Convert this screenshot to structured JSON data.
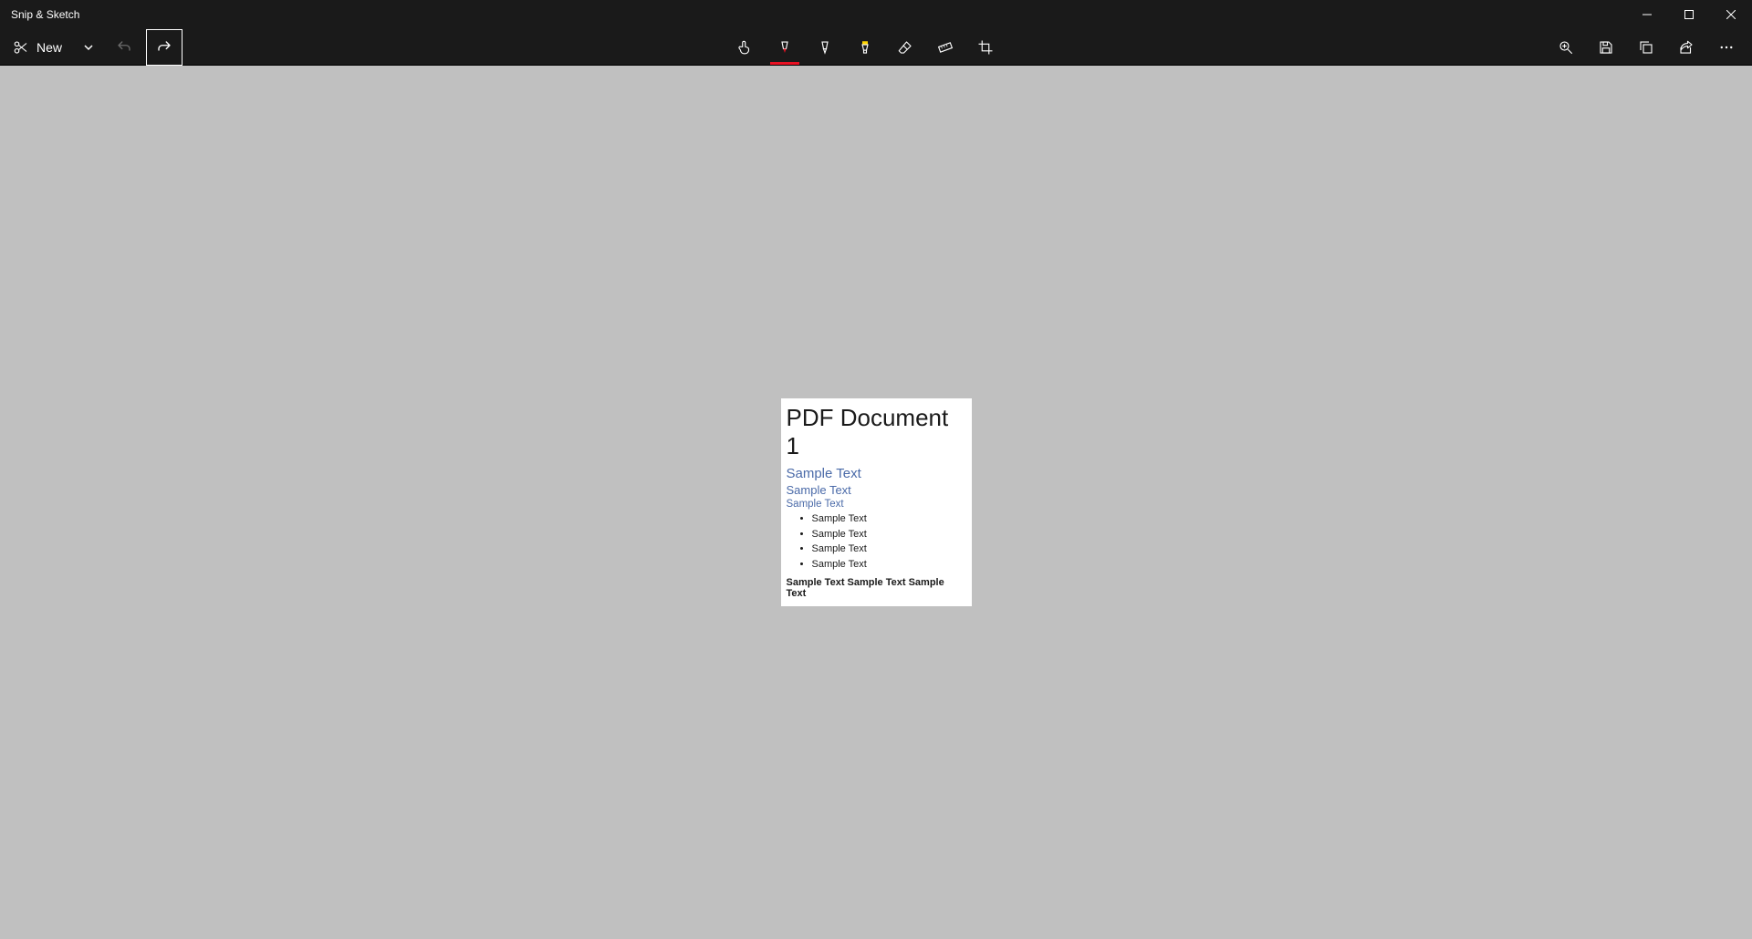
{
  "app": {
    "title": "Snip & Sketch"
  },
  "toolbar": {
    "new_label": "New"
  },
  "snip": {
    "title": "PDF Document 1",
    "h2": "Sample Text",
    "h3": "Sample Text",
    "h4": "Sample Text",
    "bullets": [
      "Sample Text",
      "Sample Text",
      "Sample Text",
      "Sample Text"
    ],
    "paragraph": "Sample Text Sample Text Sample Text"
  }
}
